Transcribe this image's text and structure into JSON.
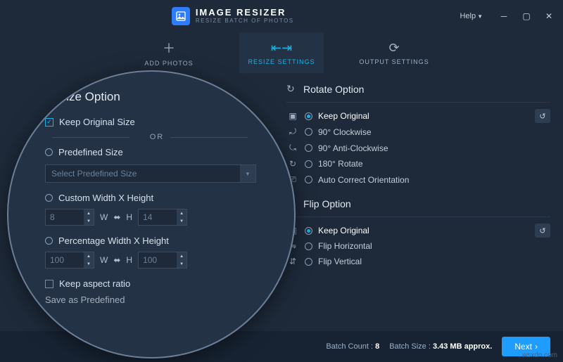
{
  "app": {
    "title": "IMAGE RESIZER",
    "subtitle": "RESIZE BATCH OF PHOTOS",
    "help": "Help"
  },
  "tabs": {
    "add": "ADD PHOTOS",
    "resize": "RESIZE SETTINGS",
    "output": "OUTPUT SETTINGS"
  },
  "resize": {
    "header": "Resize Option",
    "keep_original": "Keep Original Size",
    "or": "OR",
    "predefined": "Predefined Size",
    "predefined_placeholder": "Select Predefined Size",
    "custom": "Custom Width X Height",
    "custom_w": "8",
    "custom_h": "14",
    "wlabel": "W",
    "hlabel": "H",
    "percent": "Percentage Width X Height",
    "percent_w": "100",
    "percent_h": "100",
    "keep_aspect": "Keep aspect ratio",
    "save_predef": "Save as Predefined"
  },
  "rotate": {
    "header": "Rotate Option",
    "keep": "Keep Original",
    "cw": "90° Clockwise",
    "ccw": "90° Anti-Clockwise",
    "r180": "180° Rotate",
    "auto": "Auto Correct Orientation"
  },
  "flip": {
    "header": "Flip Option",
    "keep": "Keep Original",
    "h": "Flip Horizontal",
    "v": "Flip Vertical"
  },
  "footer": {
    "count_label": "Batch Count :",
    "count": "8",
    "size_label": "Batch Size :",
    "size": "3.43 MB approx.",
    "next": "Next"
  },
  "watermark": "wsxdn.com"
}
